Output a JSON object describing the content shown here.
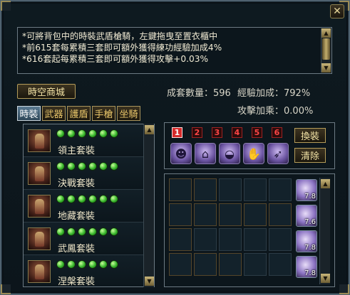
{
  "window": {
    "close_icon": "close-icon"
  },
  "info": {
    "lines": [
      "*可將背包中的時裝武盾槍騎，左鍵拖曳至置衣櫃中",
      "*前615套每累積三套即可額外獲得練功經驗加成4%",
      "*616套起每累積三套即可額外獲得攻擊+0.03%"
    ]
  },
  "shop_button": "時空商城",
  "stats": {
    "set_count_label": "成套數量：",
    "set_count_value": "596",
    "exp_bonus_label": "經驗加成：",
    "exp_bonus_value": "792%",
    "attack_label": "攻擊加乘：",
    "attack_value": "0.00%"
  },
  "tabs": [
    "時裝",
    "武器",
    "護盾",
    "手槍",
    "坐騎"
  ],
  "sets": [
    {
      "name": "領主套裝",
      "icon": "armor-icon"
    },
    {
      "name": "決戰套裝",
      "icon": "armor-icon"
    },
    {
      "name": "地藏套裝",
      "icon": "armor-icon"
    },
    {
      "name": "武鳳套裝",
      "icon": "armor-icon"
    },
    {
      "name": "涅槃套裝",
      "icon": "armor-icon"
    }
  ],
  "pages": [
    "1",
    "2",
    "3",
    "4",
    "5",
    "6"
  ],
  "slots": [
    "helmet-icon",
    "armor-icon",
    "hat-icon",
    "glove-icon",
    "wing-icon"
  ],
  "buttons": {
    "swap": "換裝",
    "clear": "清除"
  },
  "skills": [
    {
      "icon": "skill-icon",
      "level": "7.8"
    },
    {
      "icon": "skill-icon",
      "level": "7.6"
    },
    {
      "icon": "skill-icon",
      "level": "7.8"
    },
    {
      "icon": "skill-icon",
      "level": "7.8"
    }
  ]
}
